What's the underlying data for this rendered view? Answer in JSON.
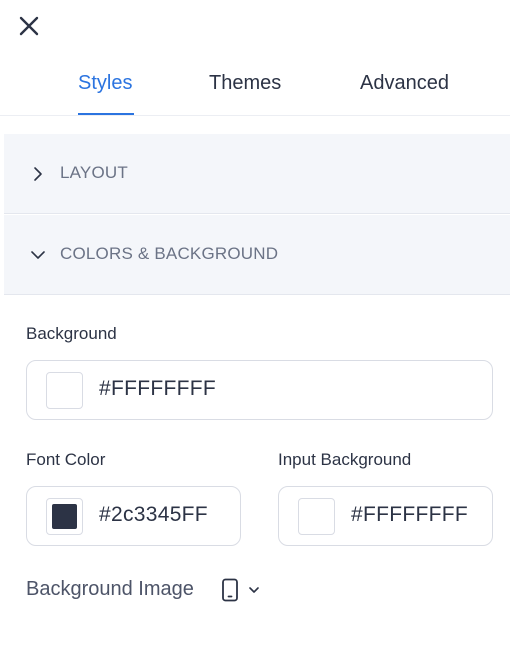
{
  "tabs": [
    {
      "label": "Styles",
      "active": true
    },
    {
      "label": "Themes",
      "active": false
    },
    {
      "label": "Advanced",
      "active": false
    }
  ],
  "sections": {
    "layout": {
      "label": "LAYOUT",
      "expanded": false,
      "icon": "chevron-right-icon"
    },
    "colors": {
      "label": "COLORS & BACKGROUND",
      "expanded": true,
      "icon": "chevron-down-icon"
    }
  },
  "fields": {
    "background": {
      "label": "Background",
      "value": "#FFFFFFFF",
      "swatch": "#FFFFFF"
    },
    "font_color": {
      "label": "Font Color",
      "value": "#2c3345FF",
      "swatch": "#2c3345"
    },
    "input_background": {
      "label": "Input Background",
      "value": "#FFFFFFFF",
      "swatch": "#FFFFFF"
    }
  },
  "background_image": {
    "label": "Background Image",
    "device_icon": "mobile-device-icon",
    "dropdown_icon": "chevron-down-icon"
  },
  "colors": {
    "accent": "#2b74e0",
    "text": "#2c3345",
    "muted": "#6b7386",
    "section_bg": "#f4f6fa",
    "border": "#d9dce4"
  }
}
